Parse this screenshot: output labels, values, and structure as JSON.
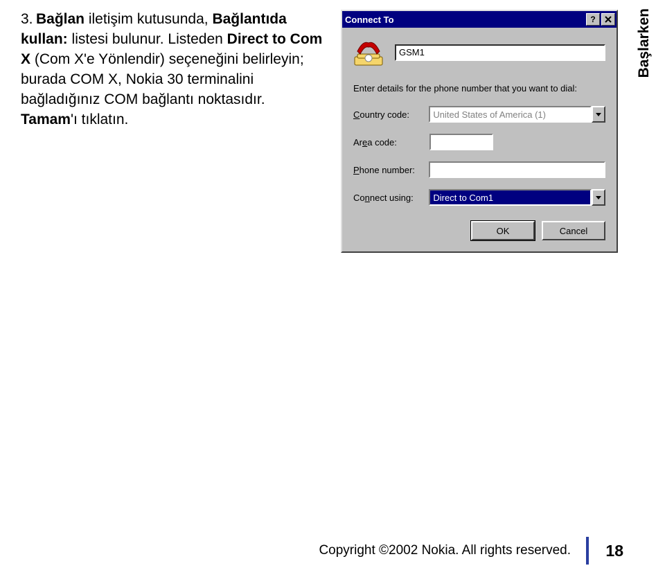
{
  "step": {
    "number": "3.",
    "line1_prefix": "",
    "bold1": "Bağlan",
    "line1_mid": " iletişim kutusunda, ",
    "bold2": "Bağlantıda kullan:",
    "line1_suffix": " listesi bulunur. Listeden ",
    "bold3": "Direct to Com X",
    "line2": " (Com X'e Yönlendir) seçeneğini belirleyin; burada COM X, Nokia 30 terminalini bağladığınız COM bağlantı noktasıdır. ",
    "bold4": "Tamam",
    "line3": "'ı tıklatın."
  },
  "dialog": {
    "title": "Connect To",
    "help_glyph": "?",
    "name_value": "GSM1",
    "instruction": "Enter details for the phone number that you want to dial:",
    "labels": {
      "country_prefix": "C",
      "country_rest": "ountry code:",
      "area_prefix": "Ar",
      "area_rest": "ea code:",
      "phone_prefix": "P",
      "phone_rest": "hone number:",
      "connect_prefix": "Co",
      "connect_underline": "n",
      "connect_rest": "nect using:"
    },
    "country_value": "United States of America (1)",
    "area_value": "",
    "phone_value": "",
    "connect_value": "Direct to Com1",
    "ok_label": "OK",
    "cancel_label": "Cancel"
  },
  "sidetab": "Başlarken",
  "footer": {
    "copyright": "Copyright ©2002 Nokia. All rights reserved.",
    "page": "18"
  }
}
